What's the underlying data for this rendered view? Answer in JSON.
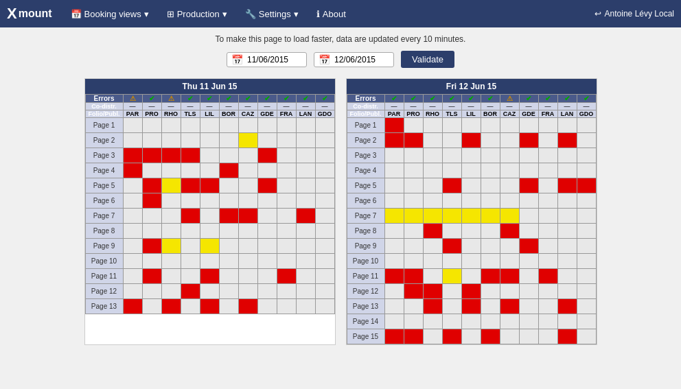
{
  "navbar": {
    "brand": "mount",
    "brand_x": "X",
    "items": [
      {
        "label": "Booking views",
        "icon": "calendar-icon",
        "has_arrow": true
      },
      {
        "label": "Production",
        "icon": "grid-icon",
        "has_arrow": true
      },
      {
        "label": "Settings",
        "icon": "wrench-icon",
        "has_arrow": true
      },
      {
        "label": "About",
        "icon": "info-icon",
        "has_arrow": false
      }
    ],
    "user": "Antoine Lévy Local",
    "user_icon": "user-icon"
  },
  "info_bar": "To make this page to load faster, data are updated every 10 minutes.",
  "date_from": "11/06/2015",
  "date_to": "12/06/2015",
  "validate_label": "Validate",
  "grid1": {
    "title": "Thu 11 Jun 15",
    "columns": [
      "PAR",
      "PRO",
      "RHO",
      "TLS",
      "LIL",
      "BOR",
      "CAZ",
      "GDE",
      "FRA",
      "LAN",
      "GDO"
    ],
    "pages": [
      "Page 1",
      "Page 2",
      "Page 3",
      "Page 4",
      "Page 5",
      "Page 6",
      "Page 7",
      "Page 8",
      "Page 9",
      "Page 10",
      "Page 11",
      "Page 12",
      "Page 13"
    ]
  },
  "grid2": {
    "title": "Fri 12 Jun 15",
    "columns": [
      "PAR",
      "PRO",
      "RHO",
      "TLS",
      "LIL",
      "BOR",
      "CAZ",
      "GDE",
      "FRA",
      "LAN",
      "GDO"
    ],
    "pages": [
      "Page 1",
      "Page 2",
      "Page 3",
      "Page 4",
      "Page 5",
      "Page 6",
      "Page 7",
      "Page 8",
      "Page 9",
      "Page 10",
      "Page 11",
      "Page 12",
      "Page 13",
      "Page 14",
      "Page 15"
    ]
  }
}
